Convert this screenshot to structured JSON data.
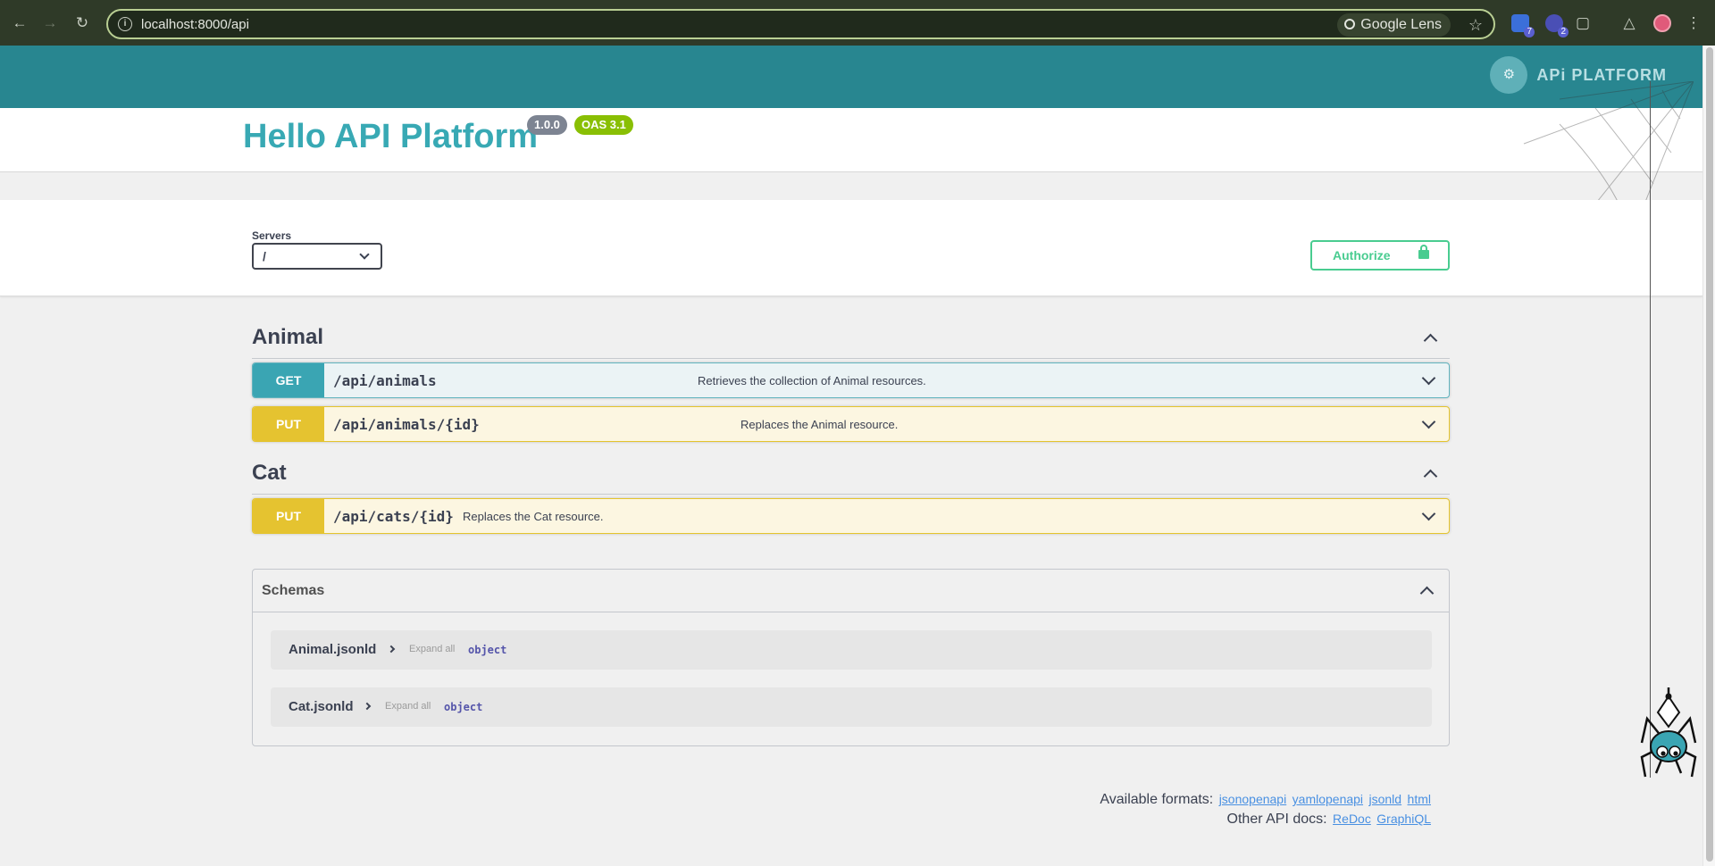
{
  "browser": {
    "url": "localhost:8000/api",
    "lens_label": "Google Lens",
    "ext_badge_1": "7",
    "ext_badge_2": "2"
  },
  "header": {
    "logo_text": "APi PLATFORM"
  },
  "info": {
    "title": "Hello API Platform",
    "version": "1.0.0",
    "oas": "OAS 3.1"
  },
  "servers": {
    "label": "Servers",
    "selected": "/"
  },
  "authorize": {
    "label": "Authorize"
  },
  "tags": [
    {
      "name": "Animal",
      "operations": [
        {
          "method": "GET",
          "path": "/api/animals",
          "summary": "Retrieves the collection of Animal resources."
        },
        {
          "method": "PUT",
          "path": "/api/animals/{id}",
          "summary": "Replaces the Animal resource."
        }
      ]
    },
    {
      "name": "Cat",
      "operations": [
        {
          "method": "PUT",
          "path": "/api/cats/{id}",
          "summary": "Replaces the Cat resource."
        }
      ]
    }
  ],
  "schemas": {
    "title": "Schemas",
    "items": [
      {
        "name": "Animal.jsonld",
        "expand_label": "Expand all",
        "type": "object"
      },
      {
        "name": "Cat.jsonld",
        "expand_label": "Expand all",
        "type": "object"
      }
    ]
  },
  "footer": {
    "formats_label": "Available formats:",
    "formats": [
      "jsonopenapi",
      "yamlopenapi",
      "jsonld",
      "html"
    ],
    "other_label": "Other API docs:",
    "other_docs": [
      "ReDoc",
      "GraphiQL"
    ]
  },
  "colors": {
    "topbar": "#288690",
    "title": "#38a9b4",
    "get": "#3aa5b3",
    "put": "#e5c330",
    "authorize": "#49cc90"
  }
}
